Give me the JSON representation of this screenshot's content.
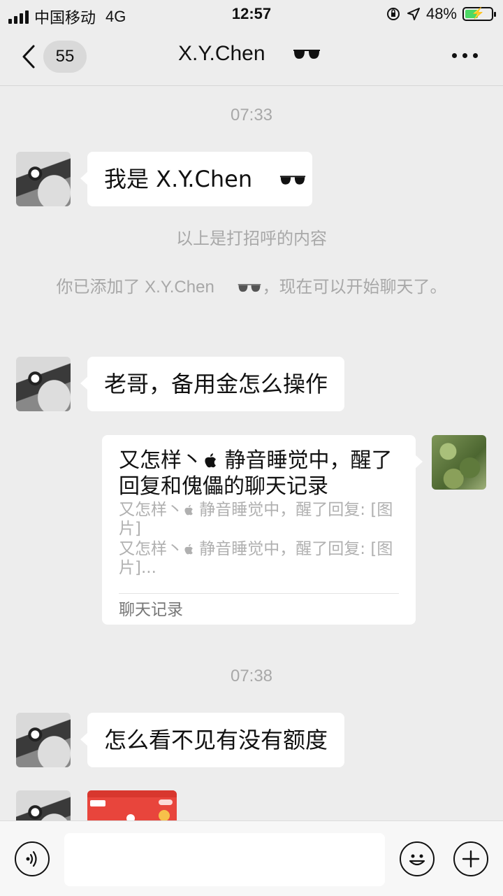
{
  "status_bar": {
    "carrier": "中国移动",
    "network": "4G",
    "time": "12:57",
    "battery_percent": "48%",
    "battery_level": 0.48,
    "icons": [
      "signal-icon",
      "orientation-lock-icon",
      "location-icon",
      "battery-charging-icon"
    ]
  },
  "header": {
    "back_icon": "chevron-left-icon",
    "unread_count": "55",
    "title": "X.Y.Chen",
    "title_emoji": "sunglasses-icon",
    "more_icon": "more-dots-icon"
  },
  "messages": {
    "ts1": "07:33",
    "msg1": "我是 X.Y.Chen",
    "sys1": "以上是打招呼的内容",
    "sys2_a": "你已添加了 X.Y.Chen",
    "sys2_b": "，现在可以开始聊天了。",
    "msg2": "老哥，备用金怎么操作",
    "record": {
      "title_a": "又怎样丶",
      "title_b": " 静音睡觉中，醒了回复和傀儡的聊天记录",
      "line1_a": "又怎样丶",
      "line1_b": " 静音睡觉中，醒了回复: [图片]",
      "line2_a": "又怎样丶",
      "line2_b": " 静音睡觉中，醒了回复: [图片]...",
      "footer": "聊天记录"
    },
    "ts2": "07:38",
    "msg3": "怎么看不见有没有额度"
  },
  "input_bar": {
    "voice_icon": "voice-icon",
    "emoji_icon": "emoji-icon",
    "add_icon": "plus-icon",
    "input_value": ""
  },
  "colors": {
    "background": "#ededed",
    "bubble": "#ffffff",
    "system_text": "#a8a8a8",
    "battery_fill": "#4cd964"
  }
}
